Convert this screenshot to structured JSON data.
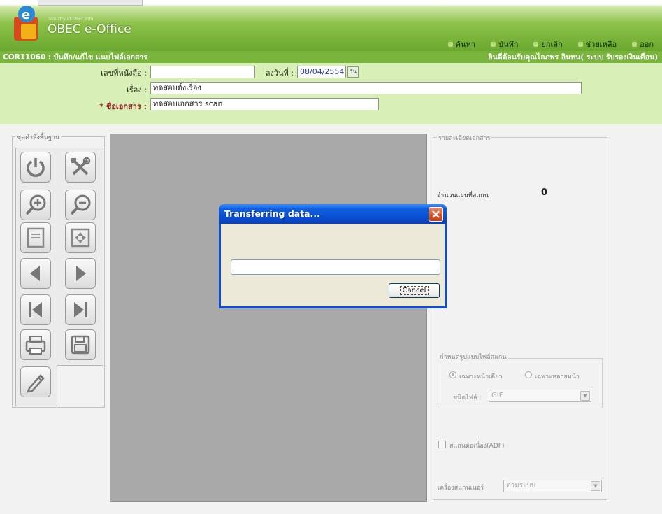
{
  "app": {
    "logo_small_text": "Ministry of OBEC Info",
    "logo_title": "OBEC e-Office"
  },
  "nav": {
    "items": [
      {
        "label": "ค้นหา"
      },
      {
        "label": "บันทึก"
      },
      {
        "label": "ยกเลิก"
      },
      {
        "label": "ช่วยเหลือ"
      },
      {
        "label": "ออก"
      }
    ]
  },
  "titlebar": {
    "screen_title": "COR11060 : บันทึก/แก้ไข แนบไฟล์เอกสาร",
    "welcome": "ยินดีต้อนรับคุณไลภพร อินทน( ระบบ รับรองเงินเดือน)"
  },
  "form": {
    "doc_number_label": "เลขที่หนังสือ :",
    "doc_number_value": "",
    "date_label": "ลงวันที่ :",
    "date_value": "08/04/2554",
    "calendar_label": "วัน",
    "subject_label": "เรื่อง :",
    "subject_value": "ทดสอบตั้งเรื่อง",
    "docname_label": "* ชื่อเอกสาร :",
    "docname_value": "ทดสอบเอกสาร scan"
  },
  "toolbar": {
    "legend": "ชุดคำสั่งพื้นฐาน",
    "buttons": [
      {
        "name": "power-icon"
      },
      {
        "name": "tools-icon"
      },
      {
        "name": "zoom-in-icon"
      },
      {
        "name": "zoom-out-icon"
      },
      {
        "name": "actual-size-icon"
      },
      {
        "name": "fit-page-icon"
      },
      {
        "name": "prev-page-icon"
      },
      {
        "name": "next-page-icon"
      },
      {
        "name": "first-page-icon"
      },
      {
        "name": "last-page-icon"
      },
      {
        "name": "scan-icon"
      },
      {
        "name": "save-image-icon"
      },
      {
        "name": "pen-icon"
      }
    ]
  },
  "right_panel": {
    "legend": "รายละเอียดเอกสาร",
    "page_count_label": "จำนวนแผ่นที่สแกน",
    "page_count": "0",
    "scan_group_label": "กำหนดรูปแบบไฟล์สแกน",
    "radio_1": "เฉพาะหน้าเดียว",
    "radio_2": "เฉพาะหลายหน้า",
    "filetype_label": "ชนิดไฟล์ :",
    "filetype_value": "GIF",
    "checkbox_label": "สแกนต่อเนื่อง(ADF)",
    "scanner_label": "เครื่องสแกนเนอร์",
    "scanner_value": "ตามระบบ"
  },
  "dialog": {
    "title": "Transferring data...",
    "cancel_label": "Cancel",
    "progress": 0
  },
  "colors": {
    "header_green": "#6aa82f",
    "titlebar_green": "#79b53c",
    "form_bg": "#d8f0b8",
    "xp_blue": "#0a4fd6"
  }
}
